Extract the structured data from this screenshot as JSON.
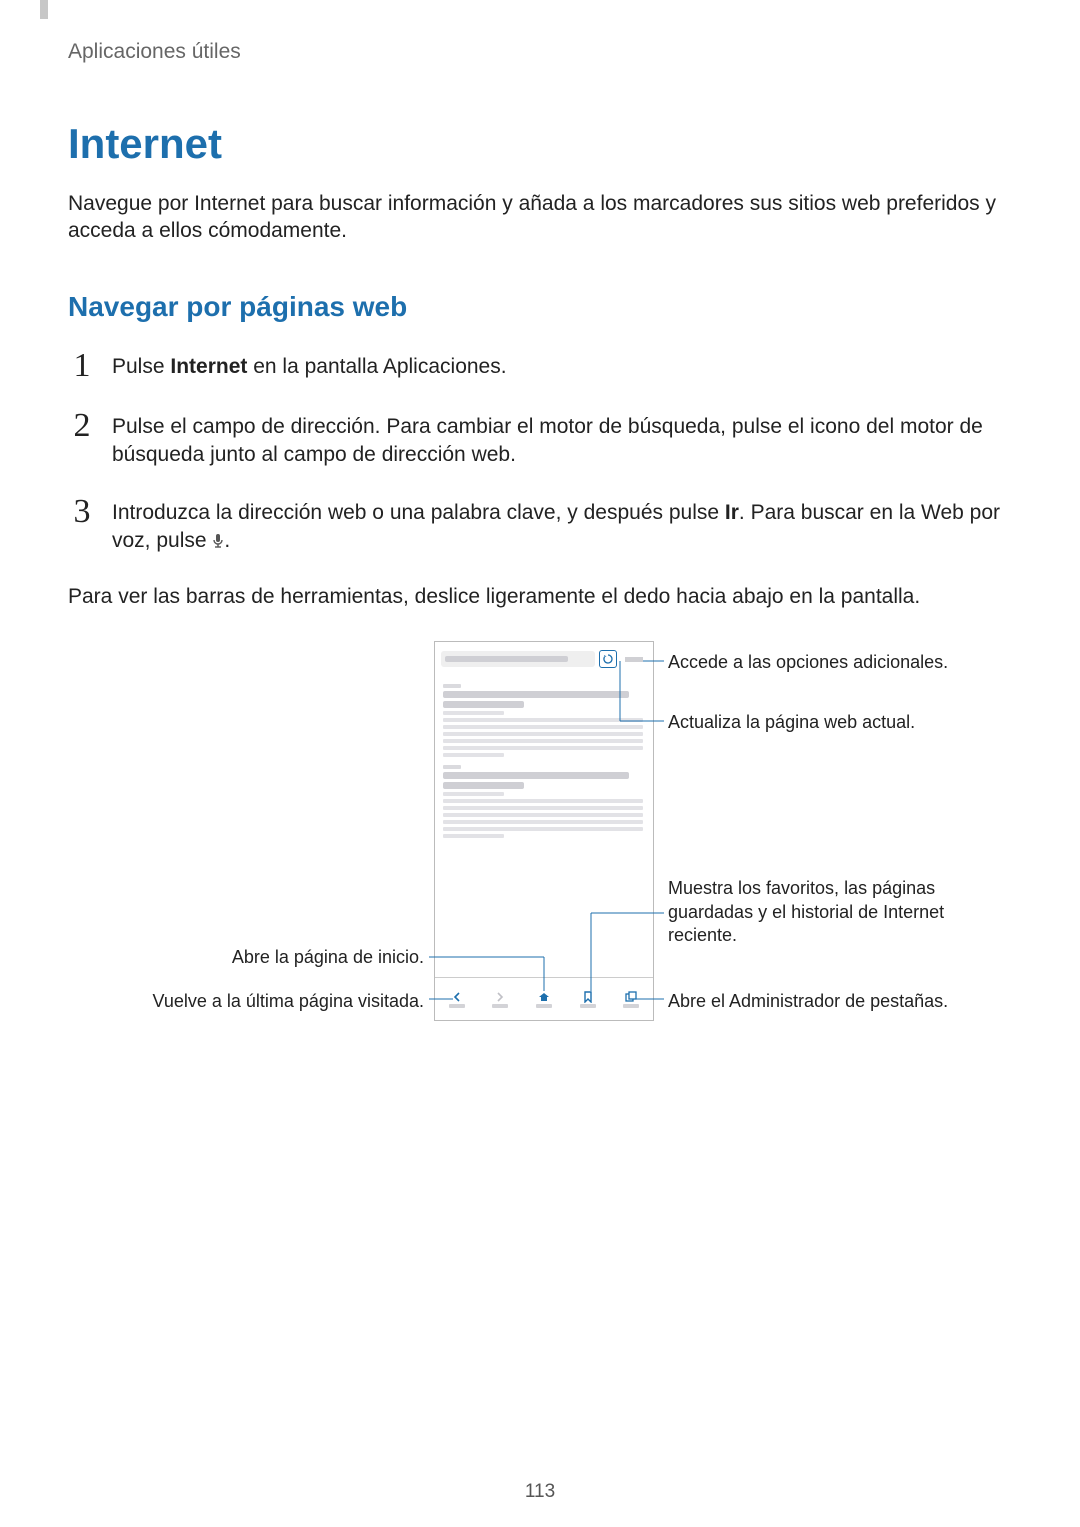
{
  "page": {
    "breadcrumb": "Aplicaciones útiles",
    "h1": "Internet",
    "intro": "Navegue por Internet para buscar información y añada a los marcadores sus sitios web preferidos y acceda a ellos cómodamente.",
    "h2": "Navegar por páginas web",
    "steps": {
      "s1_pre": "Pulse ",
      "s1_bold": "Internet",
      "s1_post": " en la pantalla Aplicaciones.",
      "s2": "Pulse el campo de dirección. Para cambiar el motor de búsqueda, pulse el icono del motor de búsqueda junto al campo de dirección web.",
      "s3_pre": "Introduzca la dirección web o una palabra clave, y después pulse ",
      "s3_bold": "Ir",
      "s3_mid": ". Para buscar en la Web por voz, pulse ",
      "s3_post": "."
    },
    "body_after": "Para ver las barras de herramientas, deslice ligeramente el dedo hacia abajo en la pantalla.",
    "callouts": {
      "more": "Accede a las opciones adicionales.",
      "refresh": "Actualiza la página web actual.",
      "bookmarks": "Muestra los favoritos, las páginas guardadas y el historial de Internet reciente.",
      "home": "Abre la página de inicio.",
      "back": "Vuelve a la última página visitada.",
      "tabs": "Abre el Administrador de pestañas."
    },
    "page_number": "113"
  }
}
